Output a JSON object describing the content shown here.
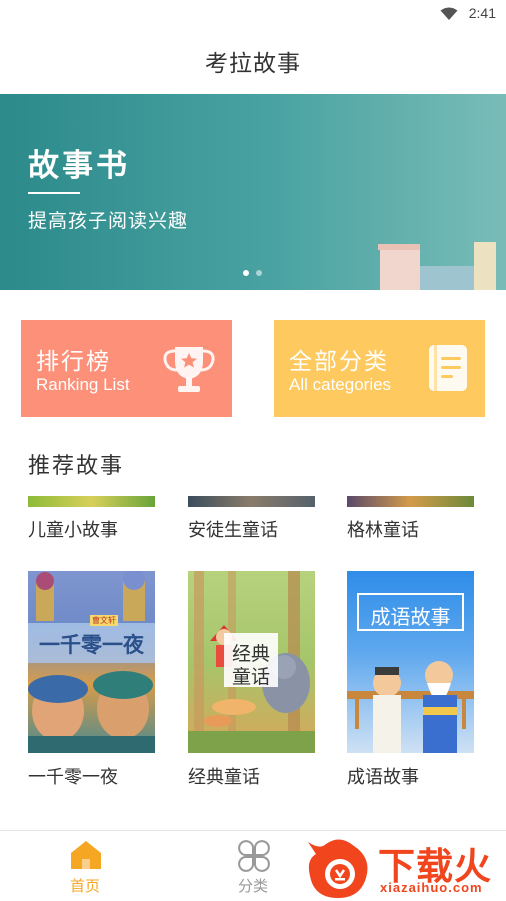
{
  "status": {
    "time": "2:41"
  },
  "header": {
    "title": "考拉故事"
  },
  "banner": {
    "title": "故事书",
    "subtitle": "提高孩子阅读兴趣",
    "active_dot": 0,
    "dot_count": 2
  },
  "cards": {
    "ranking": {
      "title": "排行榜",
      "subtitle": "Ranking List",
      "icon": "trophy-icon"
    },
    "categories": {
      "title": "全部分类",
      "subtitle": "All categories",
      "icon": "book-icon"
    }
  },
  "section": {
    "title": "推荐故事"
  },
  "stories": [
    {
      "label": "儿童小故事"
    },
    {
      "label": "安徒生童话"
    },
    {
      "label": "格林童话"
    },
    {
      "label": "一千零一夜",
      "cover_text": "一千零一夜",
      "cover_small": "曹文轩"
    },
    {
      "label": "经典童话",
      "cover_text_1": "经典",
      "cover_text_2": "童话"
    },
    {
      "label": "成语故事",
      "cover_text": "成语故事"
    }
  ],
  "tabs": [
    {
      "label": "首页",
      "icon": "home-icon",
      "active": true
    },
    {
      "label": "分类",
      "icon": "category-icon",
      "active": false
    }
  ],
  "colors": {
    "banner": "#3a9898",
    "ranking_card": "#fd9079",
    "categories_card": "#fec95f",
    "tab_active": "#f5a623",
    "tab_inactive": "#999999"
  },
  "watermark": {
    "big": "下载火",
    "small": "xiazaihuo.com"
  }
}
